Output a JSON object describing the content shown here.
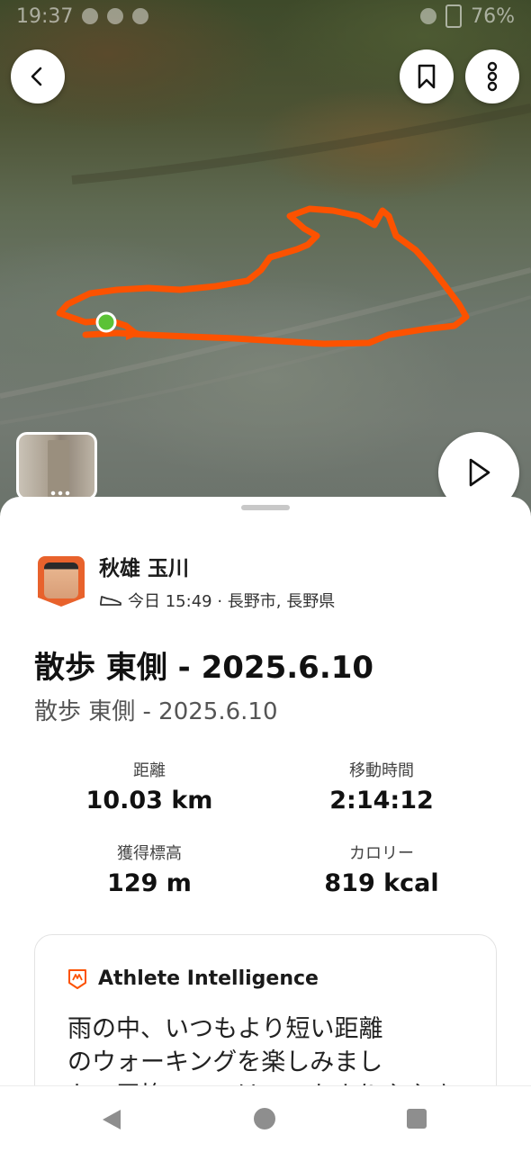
{
  "status_bar": {
    "time": "19:37",
    "battery": "76%"
  },
  "map": {
    "route_color": "#fc5200",
    "start_marker_color": "#5bc236",
    "buttons": {
      "back": "back-icon",
      "bookmark": "bookmark-icon",
      "more": "more-vertical-icon",
      "play": "play-icon"
    }
  },
  "activity": {
    "athlete_name": "秋雄 玉川",
    "meta": "今日 15:49 · 長野市, 長野県",
    "activity_icon": "shoe-icon",
    "title": "散歩 東側 - 2025.6.10",
    "description": "散歩 東側 - 2025.6.10"
  },
  "stats": {
    "distance": {
      "label": "距離",
      "value": "10.03 km"
    },
    "moving_time": {
      "label": "移動時間",
      "value": "2:14:12"
    },
    "elevation": {
      "label": "獲得標高",
      "value": "129 m"
    },
    "calories": {
      "label": "カロリー",
      "value": "819 kcal"
    }
  },
  "ai_card": {
    "title": "Athlete Intelligence",
    "line1": "雨の中、いつもより短い距離",
    "line2": "のウォーキングを楽しみまし",
    "line3": "た。平均ペースはいつもよりややゆっくりでした。"
  },
  "accent_color": "#fc5200"
}
